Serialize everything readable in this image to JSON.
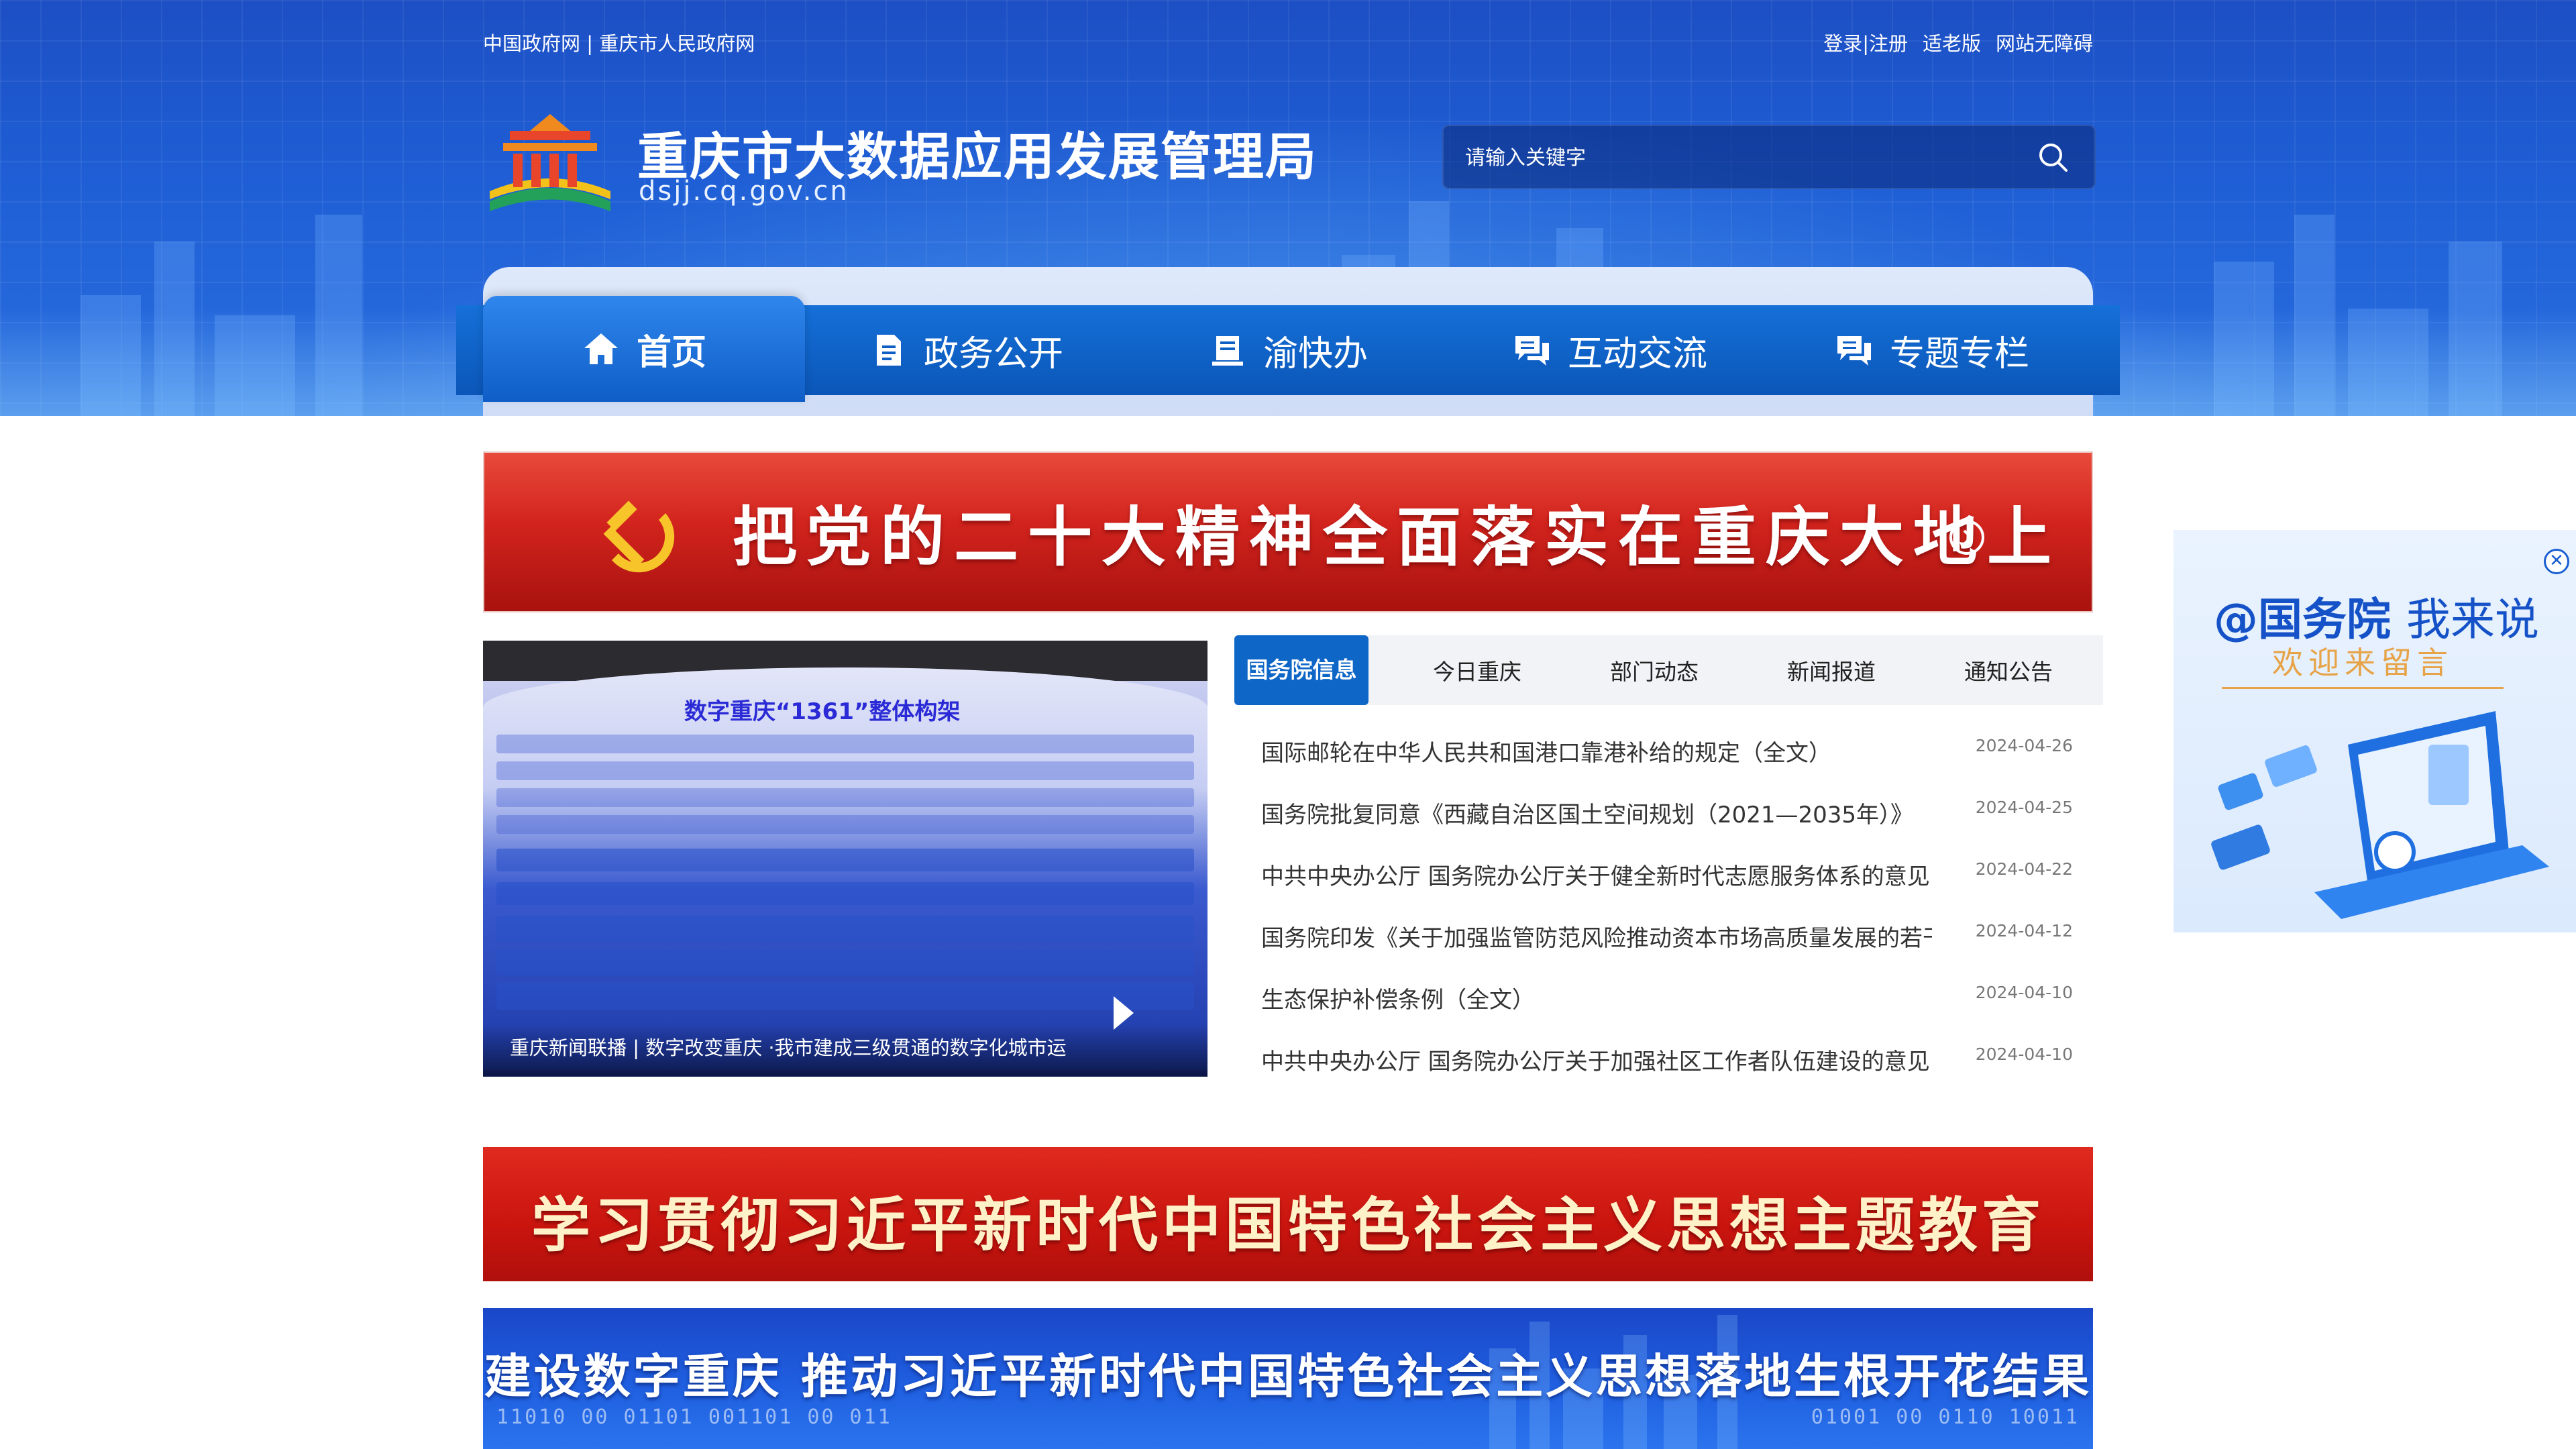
{
  "header": {
    "top_left_links": "中国政府网 | 重庆市人民政府网",
    "top_right_links": [
      {
        "label": "登录|注册"
      },
      {
        "label": "适老版"
      },
      {
        "label": "网站无障碍"
      }
    ],
    "site_title": "重庆市大数据应用发展管理局",
    "site_domain": "dsjj.cq.gov.cn",
    "search_placeholder": "请输入关键字"
  },
  "nav": {
    "items": [
      {
        "label": "首页",
        "icon": "home-icon",
        "active": true
      },
      {
        "label": "政务公开",
        "icon": "document-icon"
      },
      {
        "label": "渝快办",
        "icon": "book-icon"
      },
      {
        "label": "互动交流",
        "icon": "chat-icon"
      },
      {
        "label": "专题专栏",
        "icon": "chat-icon"
      }
    ]
  },
  "banner_party": {
    "text": "把党的二十大精神全面落实在重庆大地上",
    "icon": "hammer-sickle-icon"
  },
  "video": {
    "board_title": "数字重庆“1361”整体构架",
    "caption": "重庆新闻联播 | 数字改变重庆 ·我市建成三级贯通的数字化城市运"
  },
  "news": {
    "tabs": [
      "国务院信息",
      "今日重庆",
      "部门动态",
      "新闻报道",
      "通知公告"
    ],
    "active_tab": "国务院信息",
    "items": [
      {
        "title": "国际邮轮在中华人民共和国港口靠港补给的规定（全文）",
        "date": "2024-04-26"
      },
      {
        "title": "国务院批复同意《西藏自治区国土空间规划（2021—2035年）》",
        "date": "2024-04-25"
      },
      {
        "title": "中共中央办公厅 国务院办公厅关于健全新时代志愿服务体系的意见",
        "date": "2024-04-22"
      },
      {
        "title": "国务院印发《关于加强监管防范风险推动资本市场高质量发展的若干...",
        "date": "2024-04-12"
      },
      {
        "title": "生态保护补偿条例（全文）",
        "date": "2024-04-10"
      },
      {
        "title": "中共中央办公厅 国务院办公厅关于加强社区工作者队伍建设的意见",
        "date": "2024-04-10"
      }
    ]
  },
  "banner_study": {
    "text": "学习贯彻习近平新时代中国特色社会主义思想主题教育"
  },
  "banner_digital": {
    "text": "建设数字重庆  推动习近平新时代中国特色社会主义思想落地生根开花结果",
    "binary_left": "11010 00 01101 001101 00 011",
    "binary_right": "01001 00 0110 10011"
  },
  "float_ad": {
    "title_main": "@国务院",
    "title_suffix": "我来说",
    "subtitle": "欢迎来留言",
    "close_glyph": "✕"
  },
  "colors": {
    "brand_blue": "#0e66c7",
    "party_red": "#d2231d"
  }
}
